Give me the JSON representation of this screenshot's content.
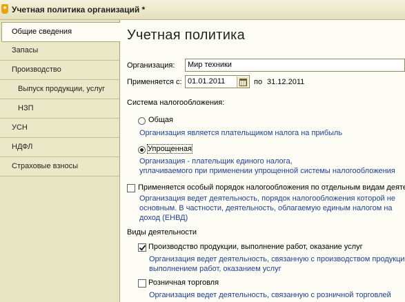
{
  "window": {
    "title": "Учетная политика организаций *"
  },
  "sidebar": {
    "items": [
      {
        "label": "Общие сведения"
      },
      {
        "label": "Запасы"
      },
      {
        "label": "Производство"
      },
      {
        "label": "Выпуск продукции, услуг"
      },
      {
        "label": "НЗП"
      },
      {
        "label": "УСН"
      },
      {
        "label": "НДФЛ"
      },
      {
        "label": "Страховые взносы"
      }
    ]
  },
  "main": {
    "heading": "Учетная политика",
    "organization_label": "Организация:",
    "organization_value": "Мир техники",
    "applies_from_label": "Применяется с:",
    "date_from": "01.01.2011",
    "date_to_prefix": "по",
    "date_to": "31.12.2011",
    "tax_system_label": "Система налогообложения:",
    "general_option": {
      "label": "Общая",
      "description": "Организация является плательщиком налога на прибыль",
      "selected": false
    },
    "simplified_option": {
      "label": "Упрощенная",
      "description_line1": "Организация - плательщик единого налога,",
      "description_line2": "уплачиваемого при применении упрощенной системы налогообложения",
      "selected": true
    },
    "special_order": {
      "label": "Применяется особый порядок налогообложения по отдельным видам деяте",
      "checked": false,
      "description_line1": "Организация ведет деятельность, порядок налогообложения которой не",
      "description_line2": "основным. В частности, деятельность, облагаемую единым налогом на",
      "description_line3": "доход (ЕНВД)"
    },
    "activities_label": "Виды деятельности",
    "production": {
      "label": "Производство  продукции, выполнение работ, оказание услуг",
      "checked": true,
      "description_line1": "Организация ведет деятельность, связанную с производством продукци",
      "description_line2": "выполнением работ, оказанием услуг"
    },
    "retail": {
      "label": "Розничная торговля",
      "checked": false,
      "description_line1": "Организация ведет деятельность, связанную с розничной торговлей"
    }
  }
}
